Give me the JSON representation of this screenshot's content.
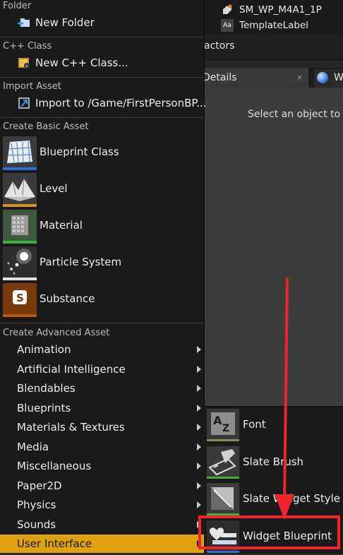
{
  "background": {
    "outliner_rows": [
      {
        "icon": "static-mesh-icon",
        "label": "SM_WP_M4A1_1P"
      },
      {
        "icon": "text-render-icon",
        "icon_text": "Aa",
        "label": "TemplateLabel"
      }
    ],
    "actors_label": "actors",
    "details_tab": "Details",
    "details_close": "×",
    "world_tab": "W",
    "select_hint": "Select an object to v"
  },
  "menu": {
    "folder": {
      "header": "Folder",
      "new_folder": "New Folder"
    },
    "cpp": {
      "header": "C++ Class",
      "new_cpp": "New C++ Class..."
    },
    "import": {
      "header": "Import Asset",
      "import_to": "Import to /Game/FirstPersonBP..."
    },
    "basic": {
      "header": "Create Basic Asset",
      "items": [
        {
          "label": "Blueprint Class",
          "accent": "#2f6fd1"
        },
        {
          "label": "Level",
          "accent": "#e0901a"
        },
        {
          "label": "Material",
          "accent": "#3fae3f"
        },
        {
          "label": "Particle System",
          "accent": "#e2e2e2"
        },
        {
          "label": "Substance",
          "accent": "#b95a12"
        }
      ]
    },
    "advanced": {
      "header": "Create Advanced Asset",
      "items": [
        {
          "label": "Animation"
        },
        {
          "label": "Artificial Intelligence"
        },
        {
          "label": "Blendables"
        },
        {
          "label": "Blueprints"
        },
        {
          "label": "Materials & Textures"
        },
        {
          "label": "Media"
        },
        {
          "label": "Miscellaneous"
        },
        {
          "label": "Paper2D"
        },
        {
          "label": "Physics"
        },
        {
          "label": "Sounds"
        },
        {
          "label": "User Interface"
        }
      ],
      "active": "User Interface"
    }
  },
  "submenu": {
    "items": [
      {
        "label": "Font",
        "icon": "font-icon",
        "glyph": "AZ"
      },
      {
        "label": "Slate Brush",
        "icon": "slate-brush-icon"
      },
      {
        "label": "Slate Widget Style",
        "icon": "slate-widget-style-icon"
      },
      {
        "label": "Widget Blueprint",
        "icon": "widget-blueprint-icon"
      }
    ],
    "highlighted": "Widget Blueprint"
  },
  "colors": {
    "menu_bg": "#1a1a1a",
    "active_item": "#e0a10f",
    "annotation_red": "#f0242a"
  }
}
